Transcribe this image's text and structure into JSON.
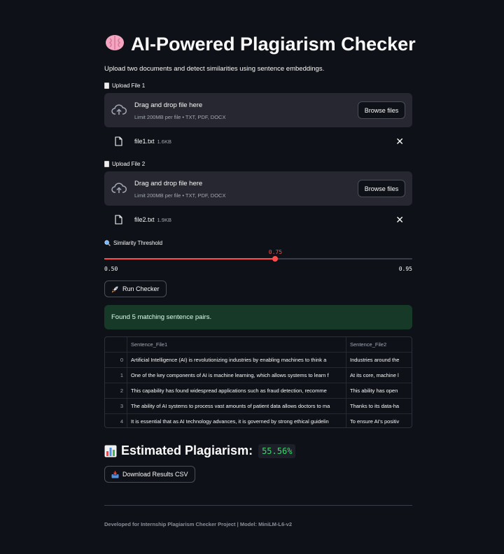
{
  "header": {
    "title": "AI-Powered Plagiarism Checker",
    "title_icon": "brain-emoji",
    "subtitle": "Upload two documents and detect similarities using sentence embeddings."
  },
  "upload1": {
    "label": "Upload File 1",
    "drop_text": "Drag and drop file here",
    "limit_text": "Limit 200MB per file • TXT, PDF, DOCX",
    "browse_label": "Browse files",
    "file_name": "file1.txt",
    "file_size": "1.6KB"
  },
  "upload2": {
    "label": "Upload File 2",
    "drop_text": "Drag and drop file here",
    "limit_text": "Limit 200MB per file • TXT, PDF, DOCX",
    "browse_label": "Browse files",
    "file_name": "file2.txt",
    "file_size": "1.9KB"
  },
  "slider": {
    "label": "Similarity Threshold",
    "value": 0.75,
    "value_text": "0.75",
    "min_text": "0.50",
    "max_text": "0.95",
    "min": 0.5,
    "max": 0.95,
    "accent": "#ff4b4b"
  },
  "run_button": {
    "label": "Run Checker",
    "icon": "rocket-emoji"
  },
  "success_message": "Found 5 matching sentence pairs.",
  "table": {
    "columns": [
      "",
      "Sentence_File1",
      "Sentence_File2"
    ],
    "rows": [
      [
        "0",
        "Artificial Intelligence (AI) is revolutionizing industries by enabling machines to think a",
        "Industries around the"
      ],
      [
        "1",
        "One of the key components of AI is machine learning, which allows systems to learn f",
        "At its core, machine l"
      ],
      [
        "2",
        "This capability has found widespread applications such as fraud detection, recomme",
        "This ability has open"
      ],
      [
        "3",
        "The ability of AI systems to process vast amounts of patient data allows doctors to ma",
        "Thanks to its data-ha"
      ],
      [
        "4",
        "It is essential that as AI technology advances, it is governed by strong ethical guidelin",
        "To ensure AI's positiv"
      ]
    ]
  },
  "plagiarism": {
    "label": "Estimated Plagiarism:",
    "value": "55.56%",
    "icon": "bar-chart-emoji",
    "value_color": "#3dd56d"
  },
  "download_button": {
    "label": "Download Results CSV",
    "icon": "inbox-tray-emoji"
  },
  "footer": "Developed for Internship Plagiarism Checker Project | Model: MiniLM-L6-v2"
}
